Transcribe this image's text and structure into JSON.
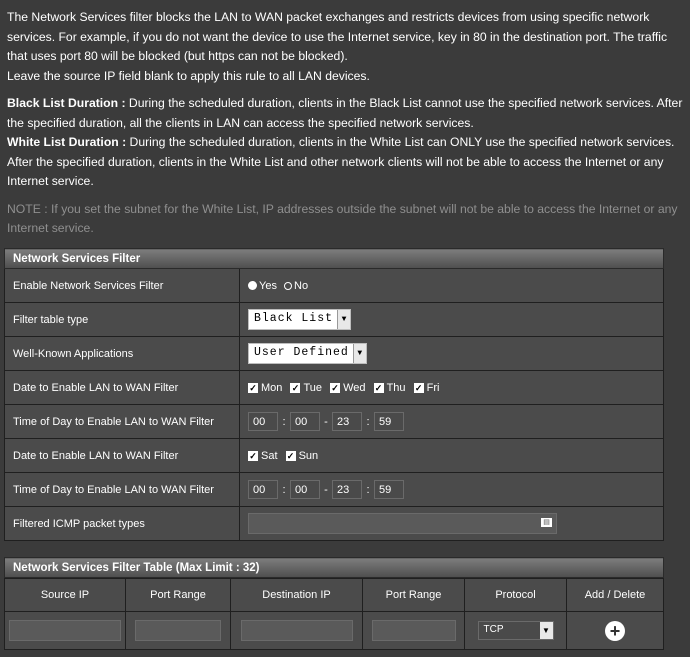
{
  "intro": {
    "p1": "The Network Services filter blocks the LAN to WAN packet exchanges and restricts devices from using specific network services. For example, if you do not want the device to use the Internet service, key in 80 in the destination port. The traffic that uses port 80 will be blocked (but https can not be blocked).",
    "p2": "Leave the source IP field blank to apply this rule to all LAN devices.",
    "black_label": "Black List Duration :",
    "black_text": "During the scheduled duration, clients in the Black List cannot use the specified network services. After the specified duration, all the clients in LAN can access the specified network services.",
    "white_label": "White List Duration :",
    "white_text": "During the scheduled duration, clients in the White List can ONLY use the specified network services. After the specified duration, clients in the White List and other network clients will not be able to access the Internet or any Internet service.",
    "note_label": "NOTE :",
    "note_text": "If you set the subnet for the White List, IP addresses outside the subnet will not be able to access the Internet or any Internet service."
  },
  "filter": {
    "title": "Network Services Filter",
    "enable_label": "Enable Network Services Filter",
    "yes": "Yes",
    "no": "No",
    "enabled": true,
    "table_type_label": "Filter table type",
    "table_type_value": "Black List",
    "wellknown_label": "Well-Known Applications",
    "wellknown_value": "User Defined",
    "date_label": "Date to Enable LAN to WAN Filter",
    "weekdays": [
      "Mon",
      "Tue",
      "Wed",
      "Thu",
      "Fri"
    ],
    "time_label": "Time of Day to Enable LAN to WAN Filter",
    "weekday_time": [
      "00",
      "00",
      "23",
      "59"
    ],
    "weekend": [
      "Sat",
      "Sun"
    ],
    "weekend_time": [
      "00",
      "00",
      "23",
      "59"
    ],
    "icmp_label": "Filtered ICMP packet types",
    "icmp_value": ""
  },
  "table": {
    "title": "Network Services Filter Table (Max Limit : 32)",
    "columns": [
      "Source IP",
      "Port Range",
      "Destination IP",
      "Port Range",
      "Protocol",
      "Add / Delete"
    ],
    "protocol": "TCP"
  }
}
